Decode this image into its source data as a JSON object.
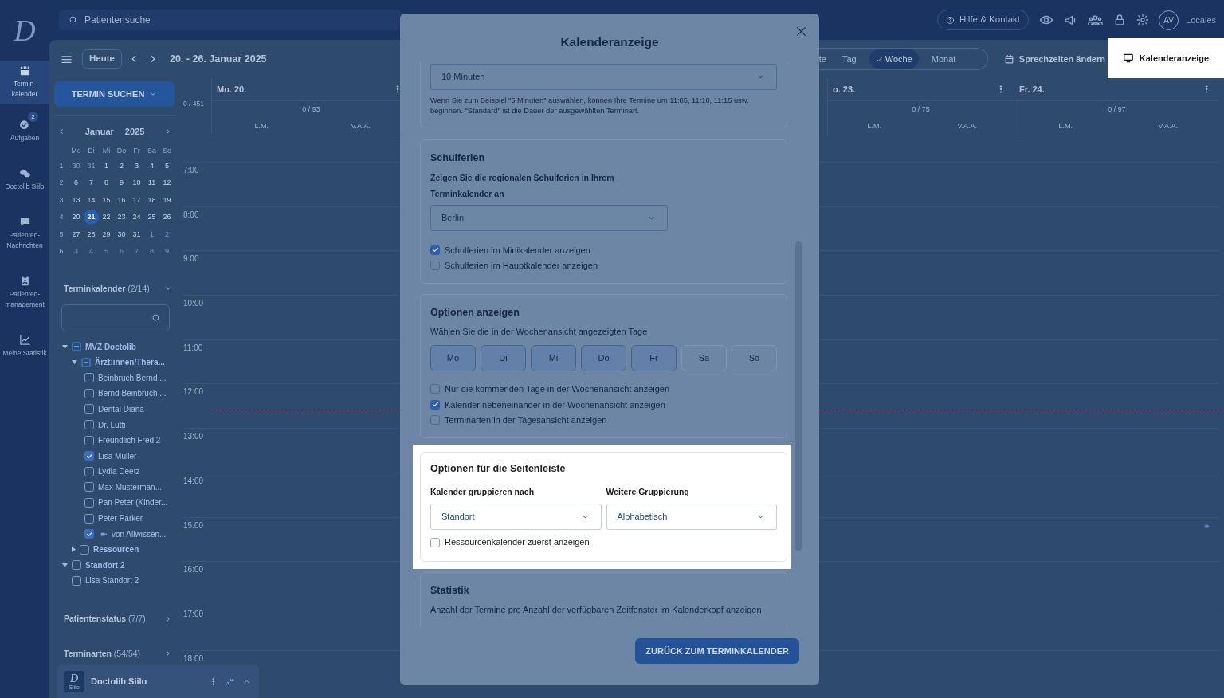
{
  "nav": {
    "logo": "D",
    "items": [
      {
        "kind": "calendar",
        "label_lines": [
          "Termin-",
          "kalender"
        ],
        "selected": true
      },
      {
        "kind": "tasks",
        "label_lines": [
          "Aufgaben"
        ],
        "selected": false,
        "badge": "2"
      },
      {
        "kind": "chat",
        "label_lines": [
          "Doctolib Siilo"
        ],
        "selected": false
      },
      {
        "kind": "message",
        "label_lines": [
          "Patienten-",
          "Nachrichten"
        ],
        "selected": false
      },
      {
        "kind": "clipboard",
        "label_lines": [
          "Patienten-",
          "management"
        ],
        "selected": false
      },
      {
        "kind": "chart",
        "label_lines": [
          "Meine Statistik"
        ],
        "selected": false
      }
    ]
  },
  "top_bar": {
    "search": {
      "placeholder": "Patientensuche"
    },
    "help_button": "Hilfe & Kontakt",
    "avatar": "AV",
    "locale": "Locales"
  },
  "toolbar": {
    "today_button": "Heute",
    "date_range": "20. - 26. Januar 2025",
    "view_tabs": [
      {
        "label": "te",
        "selected": false
      },
      {
        "label": "Tag",
        "selected": false
      },
      {
        "label": "Woche",
        "selected": true
      },
      {
        "label": "Monat",
        "selected": false
      }
    ],
    "office_hours_button": "Sprechzeiten ändern",
    "display_button": {
      "label": "Kalenderanzeige",
      "highlighted": true
    }
  },
  "sidebar": {
    "search_button": "TERMIN SUCHEN",
    "mini_calendar": {
      "month": "Januar",
      "year": "2025",
      "weekdays": [
        "Mo",
        "Di",
        "Mi",
        "Do",
        "Fr",
        "Sa",
        "So"
      ],
      "weeks": [
        {
          "week": "1",
          "days": [
            {
              "t": "30",
              "outside": true,
              "selected": false
            },
            {
              "t": "31",
              "outside": true,
              "selected": false
            },
            {
              "t": "1",
              "outside": false,
              "selected": false
            },
            {
              "t": "2",
              "outside": false,
              "selected": false
            },
            {
              "t": "3",
              "outside": false,
              "selected": false
            },
            {
              "t": "4",
              "outside": false,
              "selected": false
            },
            {
              "t": "5",
              "outside": false,
              "selected": false
            }
          ]
        },
        {
          "week": "2",
          "days": [
            {
              "t": "6",
              "outside": false,
              "selected": false
            },
            {
              "t": "7",
              "outside": false,
              "selected": false
            },
            {
              "t": "8",
              "outside": false,
              "selected": false
            },
            {
              "t": "9",
              "outside": false,
              "selected": false
            },
            {
              "t": "10",
              "outside": false,
              "selected": false
            },
            {
              "t": "11",
              "outside": false,
              "selected": false
            },
            {
              "t": "12",
              "outside": false,
              "selected": false
            }
          ]
        },
        {
          "week": "3",
          "days": [
            {
              "t": "13",
              "outside": false,
              "selected": false
            },
            {
              "t": "14",
              "outside": false,
              "selected": false
            },
            {
              "t": "15",
              "outside": false,
              "selected": false
            },
            {
              "t": "16",
              "outside": false,
              "selected": false
            },
            {
              "t": "17",
              "outside": false,
              "selected": false
            },
            {
              "t": "18",
              "outside": false,
              "selected": false
            },
            {
              "t": "19",
              "outside": false,
              "selected": false
            }
          ]
        },
        {
          "week": "4",
          "days": [
            {
              "t": "20",
              "outside": false,
              "selected": false
            },
            {
              "t": "21",
              "outside": false,
              "selected": true
            },
            {
              "t": "22",
              "outside": false,
              "selected": false
            },
            {
              "t": "23",
              "outside": false,
              "selected": false
            },
            {
              "t": "24",
              "outside": false,
              "selected": false
            },
            {
              "t": "25",
              "outside": false,
              "selected": false
            },
            {
              "t": "26",
              "outside": false,
              "selected": false
            }
          ]
        },
        {
          "week": "5",
          "days": [
            {
              "t": "27",
              "outside": false,
              "selected": false
            },
            {
              "t": "28",
              "outside": false,
              "selected": false
            },
            {
              "t": "29",
              "outside": false,
              "selected": false
            },
            {
              "t": "30",
              "outside": false,
              "selected": false
            },
            {
              "t": "31",
              "outside": false,
              "selected": false
            },
            {
              "t": "1",
              "outside": true,
              "selected": false
            },
            {
              "t": "2",
              "outside": true,
              "selected": false
            }
          ]
        },
        {
          "week": "6",
          "days": [
            {
              "t": "3",
              "outside": true,
              "selected": false
            },
            {
              "t": "4",
              "outside": true,
              "selected": false
            },
            {
              "t": "5",
              "outside": true,
              "selected": false
            },
            {
              "t": "6",
              "outside": true,
              "selected": false
            },
            {
              "t": "7",
              "outside": true,
              "selected": false
            },
            {
              "t": "8",
              "outside": true,
              "selected": false
            },
            {
              "t": "9",
              "outside": true,
              "selected": false
            }
          ]
        }
      ]
    },
    "calendars_title": "Terminkalender",
    "calendars_count": "(2/14)",
    "tree": [
      {
        "label": "MVZ Doctolib",
        "checked": false,
        "indeterminate": true,
        "expanded": true,
        "children": [
          {
            "label": "Ärzt:innen/Thera...",
            "checked": false,
            "indeterminate": true,
            "expanded": true,
            "children": [
              {
                "label": "Beinbruch Bernd ...",
                "checked": false,
                "video": false
              },
              {
                "label": "Bernd Beinbruch ...",
                "checked": false,
                "video": false
              },
              {
                "label": "Dental Diana",
                "checked": false,
                "video": false
              },
              {
                "label": "Dr. Lütti",
                "checked": false,
                "video": false
              },
              {
                "label": "Freundlich Fred 2",
                "checked": false,
                "video": false
              },
              {
                "label": "Lisa Müller",
                "checked": true,
                "video": false
              },
              {
                "label": "Lydia Deetz",
                "checked": false,
                "video": false
              },
              {
                "label": "Max Musterman...",
                "checked": false,
                "video": false
              },
              {
                "label": "Pan Peter (Kinder...",
                "checked": false,
                "video": false
              },
              {
                "label": "Peter Parker",
                "checked": false,
                "video": false
              },
              {
                "label": "von Allwissen...",
                "checked": true,
                "video": true
              }
            ]
          },
          {
            "label": "Ressourcen",
            "checked": false,
            "indeterminate": false,
            "expanded": false
          }
        ]
      },
      {
        "label": "Standort 2",
        "checked": false,
        "indeterminate": false,
        "expanded": true,
        "children": [
          {
            "label": "Lisa Standort 2",
            "checked": false,
            "video": false
          }
        ]
      }
    ],
    "sections": [
      {
        "title": "Patientenstatus",
        "count": "(7/7)"
      },
      {
        "title": "Terminarten",
        "count": "(54/54)"
      }
    ],
    "siilo_widget": {
      "title": "Doctolib Siilo",
      "logo": "D",
      "logo_caption": "Siilo"
    }
  },
  "calendar": {
    "total": "0 / 451",
    "days": [
      {
        "name": "Mo. 20.",
        "count": "0 / 93",
        "columns": [
          "L.M.",
          "V.A.A."
        ]
      },
      {
        "name": "o. 23.",
        "count": "0 / 75",
        "columns": [
          "L.M.",
          "V.A.A."
        ]
      },
      {
        "name": "Fr. 24.",
        "count": "0 / 97",
        "columns": [
          "L.M.",
          "V.A.A."
        ]
      }
    ],
    "times": [
      "7:00",
      "8:00",
      "9:00",
      "10:00",
      "11:00",
      "12:00",
      "13:00",
      "14:00",
      "15:00",
      "16:00",
      "17:00",
      "18:00"
    ]
  },
  "modal": {
    "title": "Kalenderanzeige",
    "interval": {
      "value": "10 Minuten",
      "help": "Wenn Sie zum Beispiel \"5 Minuten\" auswählen, können Ihre Termine um 11:05, 11:10, 11:15 usw. beginnen. \"Standard\" ist die Dauer der ausgewählten Terminart."
    },
    "school_holidays": {
      "title": "Schulferien",
      "subtitle": "Zeigen Sie die regionalen Schulferien in Ihrem Terminkalender an",
      "region": "Berlin",
      "options": [
        {
          "label": "Schulferien im Minikalender anzeigen",
          "checked": true
        },
        {
          "label": "Schulferien im Hauptkalender anzeigen",
          "checked": false
        }
      ]
    },
    "display_options": {
      "title": "Optionen anzeigen",
      "subtitle": "Wählen Sie die in der Wochenansicht angezeigten Tage",
      "days": [
        {
          "label": "Mo",
          "selected": true
        },
        {
          "label": "Di",
          "selected": true
        },
        {
          "label": "Mi",
          "selected": true
        },
        {
          "label": "Do",
          "selected": true
        },
        {
          "label": "Fr",
          "selected": true
        },
        {
          "label": "Sa",
          "selected": false
        },
        {
          "label": "So",
          "selected": false
        }
      ],
      "options": [
        {
          "label": "Nur die kommenden Tage in der Wochenansicht anzeigen",
          "checked": false
        },
        {
          "label": "Kalender nebeneinander in der Wochenansicht anzeigen",
          "checked": true
        },
        {
          "label": "Terminarten in der Tagesansicht anzeigen",
          "checked": false
        }
      ]
    },
    "sidebar_options": {
      "title": "Optionen für die Seitenleiste",
      "highlighted": true,
      "group_label": "Kalender gruppieren nach",
      "group_value": "Standort",
      "sub_label": "Weitere Gruppierung",
      "sub_value": "Alphabetisch",
      "options": [
        {
          "label": "Ressourcenkalender zuerst anzeigen",
          "checked": false
        }
      ]
    },
    "statistics": {
      "title": "Statistik",
      "text": "Anzahl der Termine pro Anzahl der verfügbaren Zeitfenster im Kalenderkopf anzeigen"
    },
    "back_button": "ZURÜCK ZUM TERMINKALENDER"
  }
}
